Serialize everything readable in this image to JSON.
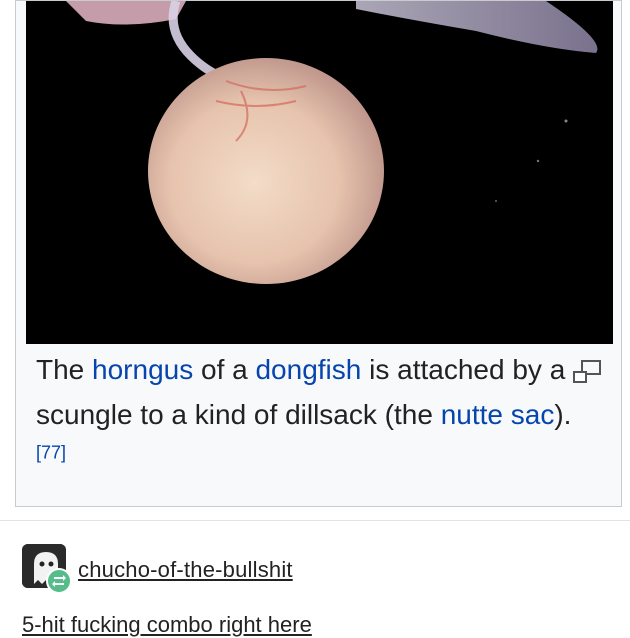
{
  "wiki": {
    "caption_parts": [
      "The ",
      "horngus",
      " of a ",
      "dongfish",
      " is attached by a ",
      "scungle",
      " to a kind of ",
      "dillsack",
      " (the ",
      "nutte sac",
      ")."
    ],
    "citation": "[77]",
    "enlarge_icon": "magnify-clip-icon"
  },
  "post": {
    "username": "chucho-of-the-bullshit",
    "text": "5-hit fucking combo right here",
    "avatar_icon": "ghost-avatar-icon",
    "reblog_icon": "reblog-icon"
  },
  "colors": {
    "link": "#0645ad",
    "reblog": "#56bc8a",
    "frame_bg": "#f8f9fa"
  }
}
